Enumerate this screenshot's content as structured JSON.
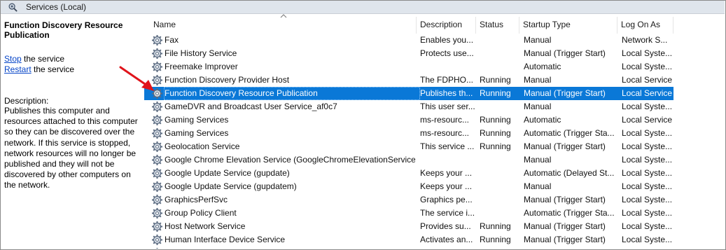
{
  "window": {
    "title": "Services (Local)"
  },
  "details": {
    "service_name": "Function Discovery Resource Publication",
    "stop_link": "Stop",
    "stop_suffix": " the service",
    "restart_link": "Restart",
    "restart_suffix": " the service",
    "description_label": "Description:",
    "description_text": "Publishes this computer and\nresources attached to this computer\nso they can be discovered over the\nnetwork.  If this service is stopped,\nnetwork resources will no longer be\npublished and they will not be\ndiscovered by other computers on\nthe network."
  },
  "columns": {
    "name": "Name",
    "description": "Description",
    "status": "Status",
    "startup_type": "Startup Type",
    "log_on_as": "Log On As"
  },
  "rows": [
    {
      "name": "Fax",
      "description": "Enables you...",
      "status": "",
      "startup": "Manual",
      "logon": "Network S..."
    },
    {
      "name": "File History Service",
      "description": "Protects use...",
      "status": "",
      "startup": "Manual (Trigger Start)",
      "logon": "Local Syste..."
    },
    {
      "name": "Freemake Improver",
      "description": "",
      "status": "",
      "startup": "Automatic",
      "logon": "Local Syste..."
    },
    {
      "name": "Function Discovery Provider Host",
      "description": "The FDPHO...",
      "status": "Running",
      "startup": "Manual",
      "logon": "Local Service"
    },
    {
      "name": "Function Discovery Resource Publication",
      "description": "Publishes th...",
      "status": "Running",
      "startup": "Manual (Trigger Start)",
      "logon": "Local Service",
      "selected": true
    },
    {
      "name": "GameDVR and Broadcast User Service_af0c7",
      "description": "This user ser...",
      "status": "",
      "startup": "Manual",
      "logon": "Local Syste..."
    },
    {
      "name": "Gaming Services",
      "description": "ms-resourc...",
      "status": "Running",
      "startup": "Automatic",
      "logon": "Local Service"
    },
    {
      "name": "Gaming Services",
      "description": "ms-resourc...",
      "status": "Running",
      "startup": "Automatic (Trigger Sta...",
      "logon": "Local Syste..."
    },
    {
      "name": "Geolocation Service",
      "description": "This service ...",
      "status": "Running",
      "startup": "Manual (Trigger Start)",
      "logon": "Local Syste..."
    },
    {
      "name": "Google Chrome Elevation Service (GoogleChromeElevationService)",
      "description": "",
      "status": "",
      "startup": "Manual",
      "logon": "Local Syste..."
    },
    {
      "name": "Google Update Service (gupdate)",
      "description": "Keeps your ...",
      "status": "",
      "startup": "Automatic (Delayed St...",
      "logon": "Local Syste..."
    },
    {
      "name": "Google Update Service (gupdatem)",
      "description": "Keeps your ...",
      "status": "",
      "startup": "Manual",
      "logon": "Local Syste..."
    },
    {
      "name": "GraphicsPerfSvc",
      "description": "Graphics pe...",
      "status": "",
      "startup": "Manual (Trigger Start)",
      "logon": "Local Syste..."
    },
    {
      "name": "Group Policy Client",
      "description": "The service i...",
      "status": "",
      "startup": "Automatic (Trigger Sta...",
      "logon": "Local Syste..."
    },
    {
      "name": "Host Network Service",
      "description": "Provides su...",
      "status": "Running",
      "startup": "Manual (Trigger Start)",
      "logon": "Local Syste..."
    },
    {
      "name": "Human Interface Device Service",
      "description": "Activates an...",
      "status": "Running",
      "startup": "Manual (Trigger Start)",
      "logon": "Local Syste..."
    },
    {
      "name": "",
      "description": "",
      "status": "",
      "startup": "",
      "logon": ""
    }
  ],
  "icons": {
    "header": "services-gear-magnifier-icon",
    "row": "service-gear-icon",
    "annotation": "red-arrow-pointer"
  },
  "colors": {
    "selection": "#0a78d7",
    "link": "#0645c8",
    "header_strip": "#dfe5ec",
    "annotation_arrow": "#e0141b"
  }
}
